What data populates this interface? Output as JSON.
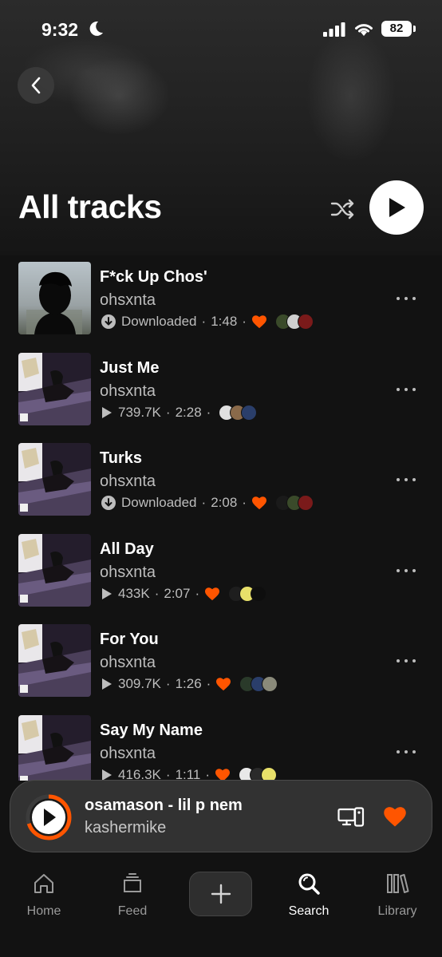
{
  "status_bar": {
    "time": "9:32",
    "battery": "82"
  },
  "page": {
    "title": "All tracks"
  },
  "tracks": [
    {
      "title": "F*ck Up Chos'",
      "artist": "ohsxnta",
      "state": "downloaded",
      "info": "Downloaded",
      "duration": "1:48",
      "liked": true,
      "art": "portrait",
      "avatars": [
        "#3a4a2a",
        "#cfcfcf",
        "#7a1a1a"
      ]
    },
    {
      "title": "Just Me",
      "artist": "ohsxnta",
      "state": "plays",
      "info": "739.7K",
      "duration": "2:28",
      "liked": false,
      "art": "room",
      "avatars": [
        "#e0e0e0",
        "#8a6a4a",
        "#2a3e6a"
      ]
    },
    {
      "title": "Turks",
      "artist": "ohsxnta",
      "state": "downloaded",
      "info": "Downloaded",
      "duration": "2:08",
      "liked": true,
      "art": "room",
      "avatars": [
        "#1a1a1a",
        "#3a4a2a",
        "#7a1a1a"
      ]
    },
    {
      "title": "All Day",
      "artist": "ohsxnta",
      "state": "plays",
      "info": "433K",
      "duration": "2:07",
      "liked": true,
      "art": "room",
      "avatars": [
        "#1e1e1e",
        "#e8e06a",
        "#0e0e0e"
      ]
    },
    {
      "title": "For You",
      "artist": "ohsxnta",
      "state": "plays",
      "info": "309.7K",
      "duration": "1:26",
      "liked": true,
      "art": "room",
      "avatars": [
        "#2a3a2a",
        "#2a3e6a",
        "#8a8a7a"
      ]
    },
    {
      "title": "Say My Name",
      "artist": "ohsxnta",
      "state": "plays",
      "info": "416.3K",
      "duration": "1:11",
      "liked": true,
      "art": "room",
      "avatars": [
        "#e8e8e8",
        "#2a2a2a",
        "#e8e06a"
      ]
    }
  ],
  "mini_player": {
    "title": "osamason - lil p nem",
    "artist": "kashermike",
    "progress": 0.7
  },
  "tabs": [
    {
      "label": "Home",
      "active": false
    },
    {
      "label": "Feed",
      "active": false
    },
    {
      "label": "Search",
      "active": true
    },
    {
      "label": "Library",
      "active": false
    }
  ],
  "colors": {
    "accent": "#ff5500",
    "background": "#121212",
    "mini_player_bg": "#343434"
  }
}
